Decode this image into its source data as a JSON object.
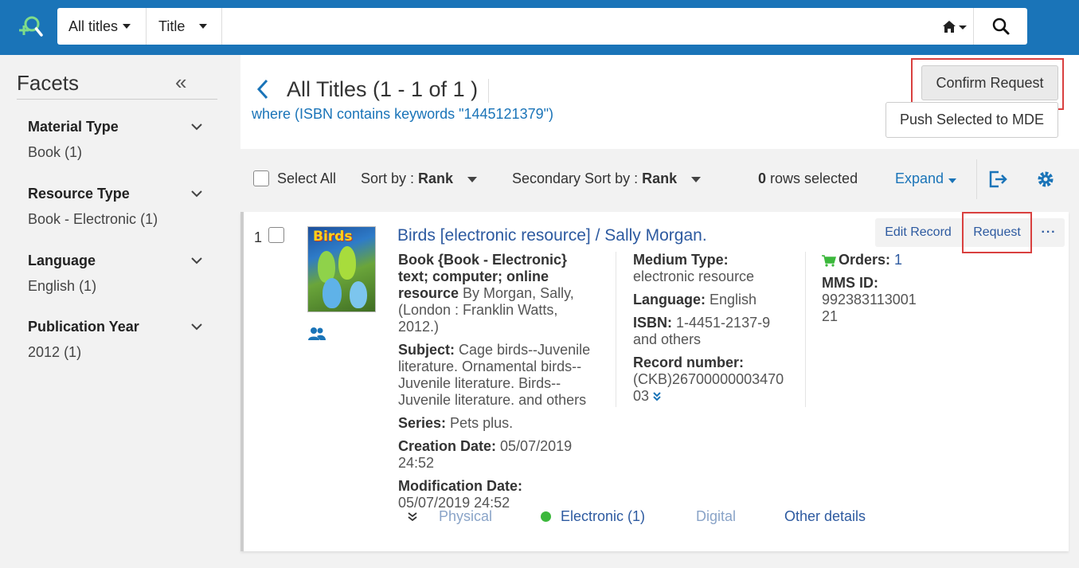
{
  "header": {
    "scope_label": "All titles",
    "field_label": "Title",
    "search_value": "",
    "icons": [
      "search-plus-logo-icon",
      "home-icon",
      "search-icon"
    ]
  },
  "facets": {
    "title": "Facets",
    "groups": [
      {
        "label": "Material Type",
        "value": "Book",
        "count": "(1)"
      },
      {
        "label": "Resource Type",
        "value": "Book - Electronic",
        "count": "(1)"
      },
      {
        "label": "Language",
        "value": "English",
        "count": "(1)"
      },
      {
        "label": "Publication Year",
        "value": "2012",
        "count": "(1)"
      }
    ]
  },
  "results_header": {
    "title": "All Titles (1 - 1 of 1 )",
    "query": "where (ISBN contains keywords \"1445121379\")",
    "confirm_label": "Confirm Request",
    "push_label": "Push Selected to MDE"
  },
  "toolbar": {
    "select_all": "Select All",
    "sort_label": "Sort by :",
    "sort_value": "Rank",
    "secondary_sort_label": "Secondary Sort by :",
    "secondary_sort_value": "Rank",
    "rows_selected_count": "0",
    "rows_selected_text": "rows selected",
    "expand_label": "Expand"
  },
  "record": {
    "number": "1",
    "cover_title": "Birds",
    "title": "Birds [electronic resource] / Sally Morgan.",
    "actions": {
      "edit": "Edit Record",
      "request": "Request",
      "more": "···"
    },
    "col1": {
      "format_label": "Book {Book - Electronic} text; computer; online resource",
      "format_rest": " By Morgan, Sally, (London : Franklin Watts, 2012.)",
      "subject_label": "Subject:",
      "subject_value": " Cage birds--Juvenile literature. Ornamental birds--Juvenile literature. Birds--Juvenile literature. and others",
      "series_label": "Series:",
      "series_value": " Pets plus.",
      "creation_label": "Creation Date:",
      "creation_value": " 05/07/2019 24:52",
      "modification_label": "Modification Date:",
      "modification_value": "05/07/2019 24:52"
    },
    "col2": {
      "medium_label": "Medium Type:",
      "medium_value": "electronic resource",
      "language_label": "Language:",
      "language_value": " English",
      "isbn_label": "ISBN:",
      "isbn_value": " 1-4451-2137-9 and others",
      "recnum_label": "Record number:",
      "recnum_value": "(CKB)2670000000347003"
    },
    "col3": {
      "orders_label": "Orders:",
      "orders_value": "1",
      "mms_label": "MMS ID:",
      "mms_value": "992383113001 21"
    },
    "tabs": {
      "physical": "Physical",
      "electronic": "Electronic (1)",
      "digital": "Digital",
      "other": "Other details"
    }
  },
  "colors": {
    "brand": "#1a74b8",
    "link": "#2d5aa0",
    "highlight": "#d9403f",
    "available": "#3cb83c"
  }
}
